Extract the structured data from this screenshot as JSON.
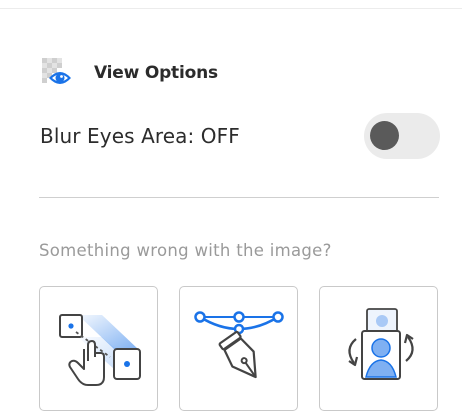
{
  "view_options": {
    "title": "View Options",
    "icon": "eye-checker-icon"
  },
  "blur_eyes": {
    "label": "Blur Eyes Area: OFF",
    "state": "off"
  },
  "problem_prompt": "Something wrong with the image?",
  "tools": [
    {
      "name": "move-crop-tool",
      "icon": "drag-crop-icon"
    },
    {
      "name": "curve-adjust-tool",
      "icon": "pen-curve-icon"
    },
    {
      "name": "swap-face-tool",
      "icon": "face-swap-icon"
    }
  ],
  "colors": {
    "accent_blue": "#1a73e8",
    "toggle_track": "#ebebeb",
    "toggle_knob": "#5a5a5a"
  }
}
